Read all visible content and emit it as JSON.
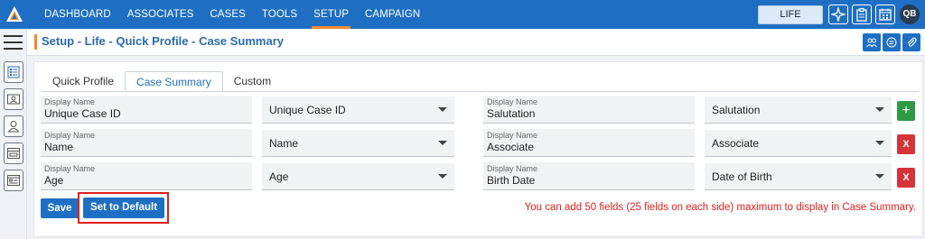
{
  "nav": {
    "items": [
      "DASHBOARD",
      "ASSOCIATES",
      "CASES",
      "TOOLS",
      "SETUP",
      "CAMPAIGN"
    ],
    "active": "SETUP",
    "line_of_business": "LIFE",
    "user_initials": "QB"
  },
  "sidebar": {
    "icons": [
      "list-settings-icon",
      "profile-card-icon",
      "user-icon",
      "browser-window-icon",
      "form-icon"
    ]
  },
  "page": {
    "title": "Setup - Life - Quick Profile - Case Summary"
  },
  "tabs": [
    {
      "label": "Quick Profile",
      "active": false
    },
    {
      "label": "Case Summary",
      "active": true
    },
    {
      "label": "Custom",
      "active": false
    }
  ],
  "form": {
    "field_label": "Display Name",
    "rows": [
      {
        "left_display": "Unique Case ID",
        "left_select": "Unique Case ID",
        "right_display": "Salutation",
        "right_select": "Salutation",
        "action": "+"
      },
      {
        "left_display": "Name",
        "left_select": "Name",
        "right_display": "Associate",
        "right_select": "Associate",
        "action": "X"
      },
      {
        "left_display": "Age",
        "left_select": "Age",
        "right_display": "Birth Date",
        "right_select": "Date of Birth",
        "action": "X"
      }
    ]
  },
  "actions": {
    "save": "Save",
    "set_default": "Set to Default"
  },
  "note": "You can add 50 fields (25 fields on each side) maximum to display in Case Summary.",
  "colors": {
    "primary": "#1e6fc4",
    "accent": "#f28b30",
    "add": "#2e9a44",
    "delete": "#d6343a",
    "warning_text": "#e0201b"
  }
}
